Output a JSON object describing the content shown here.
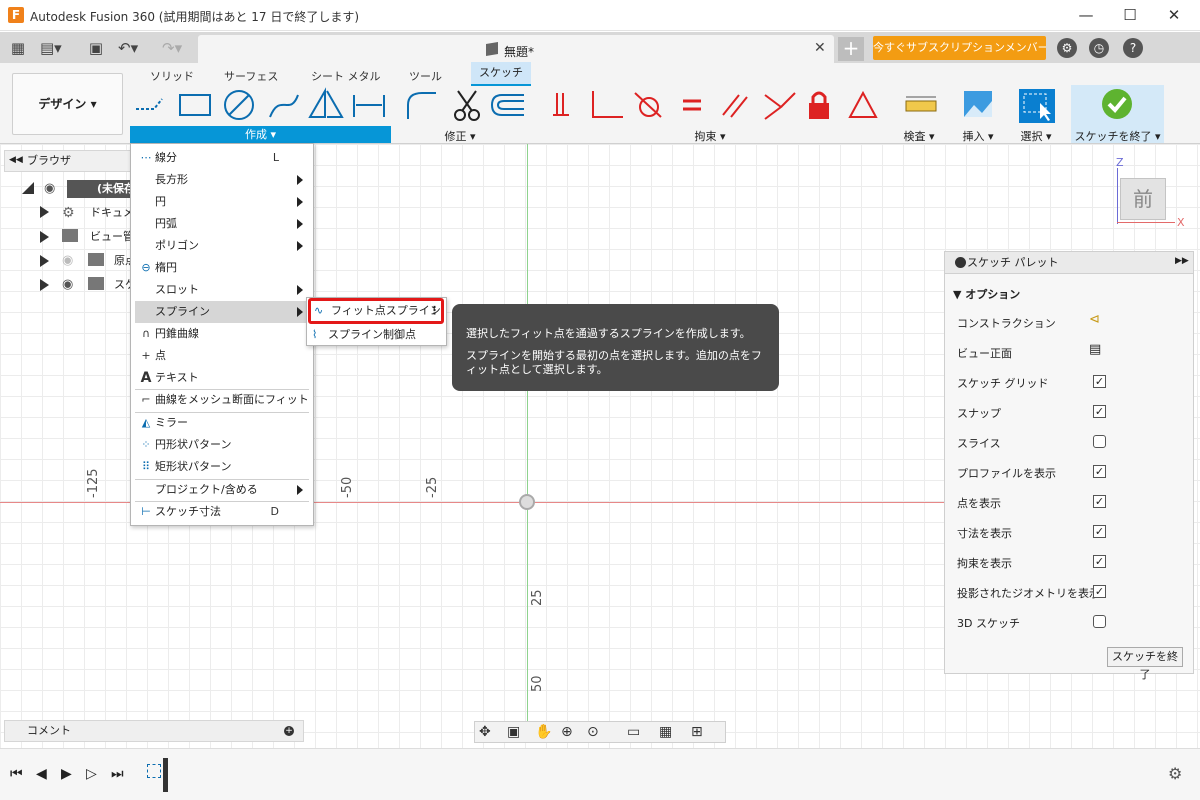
{
  "window": {
    "title": "Autodesk Fusion 360 (試用期間はあと 17 日で終了します)",
    "app_icon": "F",
    "minimize": "—",
    "maximize": "☐",
    "close": "✕"
  },
  "tabs": {
    "doc_title": "無題*",
    "subscribe_label": "今すぐサブスクリプションメンバーに..."
  },
  "ribbon": {
    "workspace_label": "デザイン ▾",
    "tabs": [
      "ソリッド",
      "サーフェス",
      "シート メタル",
      "ツール",
      "スケッチ"
    ],
    "groups": [
      "作成 ▾",
      "修正 ▾",
      "拘束 ▾",
      "検査 ▾",
      "挿入 ▾",
      "選択 ▾",
      "スケッチを終了 ▾"
    ]
  },
  "browser": {
    "title": "ブラウザ",
    "items": [
      "(未保存)",
      "ドキュメン",
      "ビュー管理",
      "原点",
      "スケ"
    ]
  },
  "create_menu": {
    "items": [
      {
        "icon": "line-icon",
        "label": "線分",
        "shortcut": "L"
      },
      {
        "icon": "",
        "label": "長方形",
        "submenu": true
      },
      {
        "icon": "",
        "label": "円",
        "submenu": true
      },
      {
        "icon": "",
        "label": "円弧",
        "submenu": true
      },
      {
        "icon": "",
        "label": "ポリゴン",
        "submenu": true
      },
      {
        "icon": "ellipse-icon",
        "label": "楕円"
      },
      {
        "icon": "",
        "label": "スロット",
        "submenu": true
      },
      {
        "icon": "",
        "label": "スプライン",
        "submenu": true,
        "highlighted": true
      },
      {
        "icon": "conic-icon",
        "label": "円錐曲線"
      },
      {
        "icon": "point-icon",
        "label": "点"
      },
      {
        "icon": "text-icon",
        "label": "テキスト"
      },
      {
        "icon": "fit-curve-icon",
        "label": "曲線をメッシュ断面にフィット"
      },
      {
        "icon": "mirror-icon",
        "label": "ミラー"
      },
      {
        "icon": "circular-pattern-icon",
        "label": "円形状パターン"
      },
      {
        "icon": "rect-pattern-icon",
        "label": "矩形状パターン"
      },
      {
        "icon": "",
        "label": "プロジェクト/含める",
        "submenu": true
      },
      {
        "icon": "dimension-icon",
        "label": "スケッチ寸法",
        "shortcut": "D"
      }
    ]
  },
  "spline_submenu": {
    "fit_point": "フィット点スプライン",
    "control_point": "スプライン制御点",
    "more": "⋮"
  },
  "tooltip": {
    "line1": "選択したフィット点を通過するスプラインを作成します。",
    "line2": "スプラインを開始する最初の点を選択します。追加の点をフィット点として選択します。"
  },
  "axis_labels": {
    "h": [
      "-125",
      "-50",
      "-25"
    ],
    "v": [
      "25",
      "50"
    ]
  },
  "viewcube": {
    "face": "前",
    "z": "Z",
    "x": "X"
  },
  "palette": {
    "title": "スケッチ パレット",
    "section": "オプション",
    "rows": [
      {
        "label": "コンストラクション",
        "type": "icon"
      },
      {
        "label": "ビュー正面",
        "type": "icon"
      },
      {
        "label": "スケッチ グリッド",
        "checked": true
      },
      {
        "label": "スナップ",
        "checked": true
      },
      {
        "label": "スライス",
        "checked": false
      },
      {
        "label": "プロファイルを表示",
        "checked": true
      },
      {
        "label": "点を表示",
        "checked": true
      },
      {
        "label": "寸法を表示",
        "checked": true
      },
      {
        "label": "拘束を表示",
        "checked": true
      },
      {
        "label": "投影されたジオメトリを表示",
        "checked": true
      },
      {
        "label": "3D スケッチ",
        "checked": false
      }
    ],
    "finish_label": "スケッチを終了"
  },
  "comments": {
    "label": "コメント"
  },
  "colors": {
    "accent": "#0696d7",
    "highlight_red": "#e31818",
    "subscribe": "#f39c12"
  }
}
